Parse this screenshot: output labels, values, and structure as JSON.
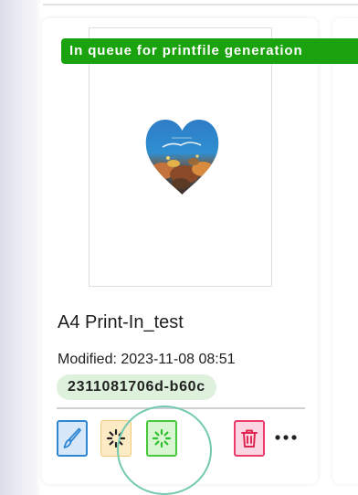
{
  "card": {
    "status_label": "In queue for printfile generation",
    "title": "A4 Print-In_test",
    "modified": "Modified: 2023-11-08 08:51",
    "id_badge": "2311081706d-b60c"
  },
  "colors": {
    "status_green": "#1aa30e",
    "edit_blue": "#2f86d1",
    "processing_orange": "#f3c879",
    "generate_green": "#46c93a",
    "delete_red": "#ea3d6b"
  },
  "icons": {
    "edit": "paintbrush-icon",
    "processing": "spinner-icon",
    "generate": "spinner-icon",
    "delete": "trash-icon",
    "more": "more-horizontal-icon"
  }
}
